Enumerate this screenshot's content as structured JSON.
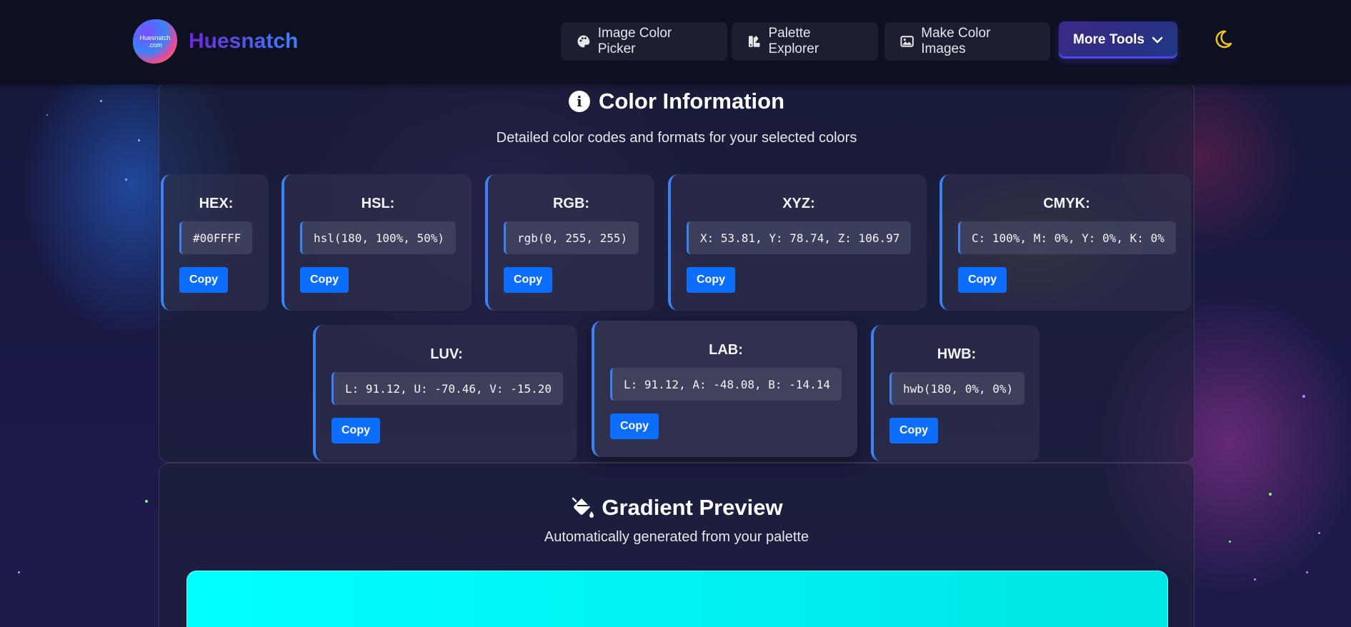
{
  "header": {
    "logo_text": "Huesnatch .com",
    "brand": "Huesnatch",
    "nav": [
      {
        "label": "Image Color Picker",
        "icon": "palette-icon"
      },
      {
        "label": "Palette Explorer",
        "icon": "swatchbook-icon"
      },
      {
        "label": "Make Color Images",
        "icon": "image-icon"
      }
    ],
    "more_tools": "More Tools",
    "theme_icon": "moon-icon"
  },
  "color_info": {
    "title": "Color Information",
    "subtitle": "Detailed color codes and formats for your selected colors",
    "cards": [
      {
        "label": "HEX:",
        "value": "#00FFFF",
        "copy": "Copy"
      },
      {
        "label": "HSL:",
        "value": "hsl(180, 100%, 50%)",
        "copy": "Copy"
      },
      {
        "label": "RGB:",
        "value": "rgb(0, 255, 255)",
        "copy": "Copy"
      },
      {
        "label": "XYZ:",
        "value": "X: 53.81, Y: 78.74, Z: 106.97",
        "copy": "Copy"
      },
      {
        "label": "CMYK:",
        "value": "C: 100%, M: 0%, Y: 0%, K: 0%",
        "copy": "Copy"
      },
      {
        "label": "LUV:",
        "value": "L: 91.12, U: -70.46, V: -15.20",
        "copy": "Copy"
      },
      {
        "label": "LAB:",
        "value": "L: 91.12, A: -48.08, B: -14.14",
        "copy": "Copy"
      },
      {
        "label": "HWB:",
        "value": "hwb(180, 0%, 0%)",
        "copy": "Copy"
      }
    ]
  },
  "gradient": {
    "title": "Gradient Preview",
    "subtitle": "Automatically generated from your palette",
    "colors": [
      "#00ffff",
      "#00e5e5"
    ]
  },
  "colors": {
    "accent": "#0d6efd",
    "card_border": "#3b82f6",
    "header_bg": "#0c1020"
  }
}
